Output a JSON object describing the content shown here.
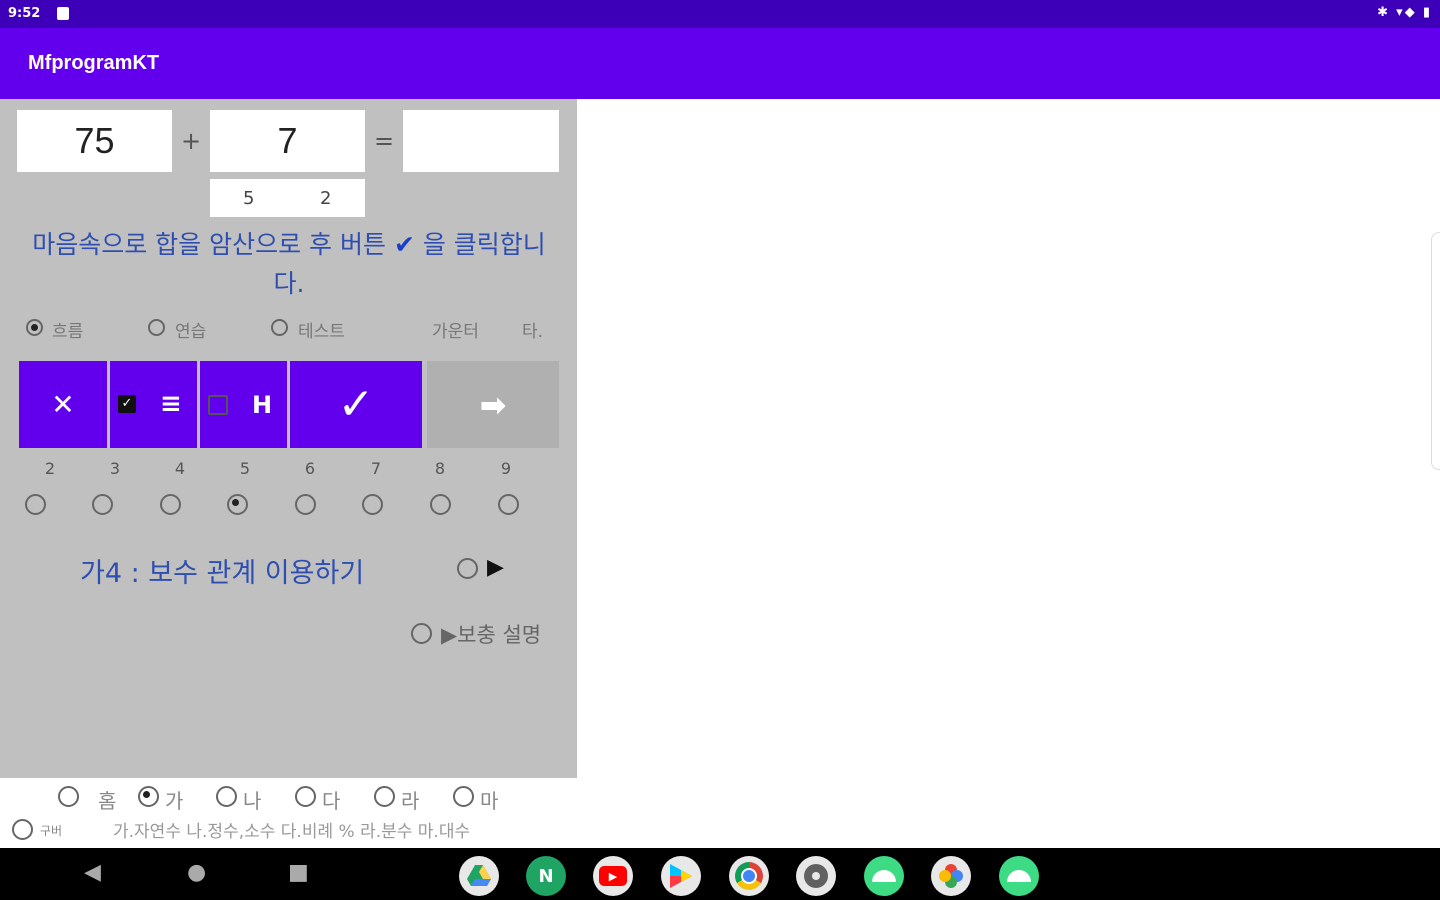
{
  "status": {
    "time": "9:52",
    "right_icons": "✱ ▾◆ ▮"
  },
  "app": {
    "title": "MfprogramKT"
  },
  "problem": {
    "a": "75",
    "op": "+",
    "b": "7",
    "eq": "=",
    "answer": "",
    "split_left": "5",
    "split_right": "2"
  },
  "instruction": {
    "part1": "마음속으로 합을 암산으로 후 버튼",
    "check": "✔",
    "part2": "을 클릭합니다."
  },
  "modes": [
    {
      "label": "흐름",
      "selected": true
    },
    {
      "label": "연습",
      "selected": false
    },
    {
      "label": "테스트",
      "selected": false
    }
  ],
  "counter_label": "가운터",
  "counter_value": "타.",
  "buttons": {
    "clear": "✕",
    "list": "≡",
    "h": "H",
    "check": "✓",
    "next": "➡"
  },
  "digits": [
    "2",
    "3",
    "4",
    "5",
    "6",
    "7",
    "8",
    "9"
  ],
  "digit_selected": "5",
  "lesson": {
    "title": "가4 :   보수 관계 이용하기",
    "play": "▶",
    "extra": "▶보충 설명"
  },
  "categories": [
    {
      "label": "홈",
      "selected": false
    },
    {
      "label": "가",
      "selected": true
    },
    {
      "label": "나",
      "selected": false
    },
    {
      "label": "다",
      "selected": false
    },
    {
      "label": "라",
      "selected": false
    },
    {
      "label": "마",
      "selected": false
    }
  ],
  "old_label": "구버",
  "category_legend": "가.자연수 나.정수,소수 다.비례 % 라.분수 마.대수",
  "nav": {
    "back": "◀",
    "home": "●",
    "recents": "■"
  },
  "dock": [
    "drive-icon",
    "n-app-icon",
    "youtube-icon",
    "play-store-icon",
    "chrome-icon",
    "settings-icon",
    "android-icon",
    "photos-icon",
    "android-icon"
  ]
}
